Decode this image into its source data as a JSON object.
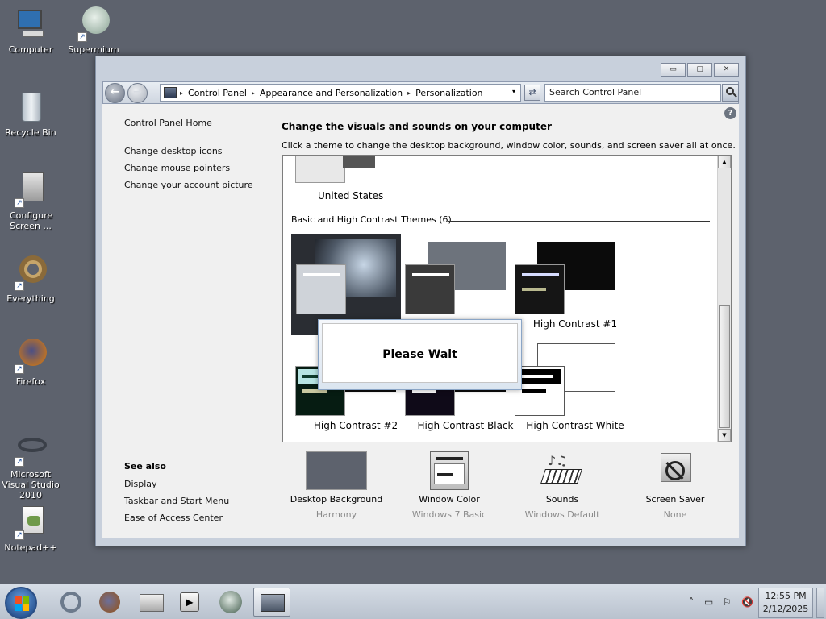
{
  "desktop": {
    "icons": [
      {
        "label": "Computer"
      },
      {
        "label": "Supermium"
      },
      {
        "label": "Recycle Bin"
      },
      {
        "label": "Configure Screen ..."
      },
      {
        "label": "Everything"
      },
      {
        "label": "Firefox"
      },
      {
        "label": "Microsoft Visual Studio 2010"
      },
      {
        "label": "Notepad++"
      }
    ],
    "shortcut_glyph": "↗"
  },
  "window": {
    "controls": {
      "minimize": "▭",
      "maximize": "▢",
      "close": "✕"
    },
    "nav": {
      "back": "←",
      "forward": "→"
    },
    "breadcrumb": [
      "Control Panel",
      "Appearance and Personalization",
      "Personalization"
    ],
    "breadcrumb_sep": "▸",
    "dropdown_glyph": "▾",
    "refresh_glyph": "⇄",
    "search_placeholder": "Search Control Panel",
    "help_glyph": "?"
  },
  "sidebar": {
    "home": "Control Panel Home",
    "links": [
      "Change desktop icons",
      "Change mouse pointers",
      "Change your account picture"
    ],
    "see_also_title": "See also",
    "see_also": [
      "Display",
      "Taskbar and Start Menu",
      "Ease of Access Center"
    ]
  },
  "main": {
    "title": "Change the visuals and sounds on your computer",
    "subtitle": "Click a theme to change the desktop background, window color, sounds, and screen saver all at once.",
    "partial_theme_label": "United States",
    "group_header": "Basic and High Contrast Themes (6)",
    "themes": [
      {
        "label": "",
        "back": "#0b0b0b",
        "front_bg": "#1b1b1b",
        "bar1": "#ffffff",
        "bar2": "#a8a889"
      },
      {
        "label": "",
        "back": "#6d737c",
        "front_bg": "#3a3a3a",
        "bar1": "#ffffff",
        "bar2": "#d0d0d0"
      },
      {
        "label": "High Contrast #1",
        "back": "#0b0b0b",
        "front_bg": "#151515",
        "bar1": "#d6dcff",
        "bar2": "#b8b88e"
      },
      {
        "label": "High Contrast #2",
        "back": "#0b0b0b",
        "front_bg": "#061c12",
        "bar1": "#0e3a2a",
        "bar2": "#c8c8a0"
      },
      {
        "label": "High Contrast Black",
        "back": "#0b0b0b",
        "front_bg": "#0f0a18",
        "bar1": "#f0d4ff",
        "bar2": "#ffffff"
      },
      {
        "label": "High Contrast White",
        "back": "#ffffff",
        "front_bg": "#ffffff",
        "bar1": "#000000",
        "bar2": "#000000"
      }
    ],
    "scroll_up": "▲",
    "scroll_down": "▼",
    "dialog_text": "Please Wait"
  },
  "customize": [
    {
      "name": "Desktop Background",
      "value": "Harmony"
    },
    {
      "name": "Window Color",
      "value": "Windows 7 Basic"
    },
    {
      "name": "Sounds",
      "value": "Windows Default"
    },
    {
      "name": "Screen Saver",
      "value": "None"
    }
  ],
  "taskbar": {
    "tray": {
      "chevron": "˄",
      "network": "▭",
      "flag": "⚐",
      "volume": "🔇"
    },
    "time": "12:55 PM",
    "date": "2/12/2025"
  }
}
